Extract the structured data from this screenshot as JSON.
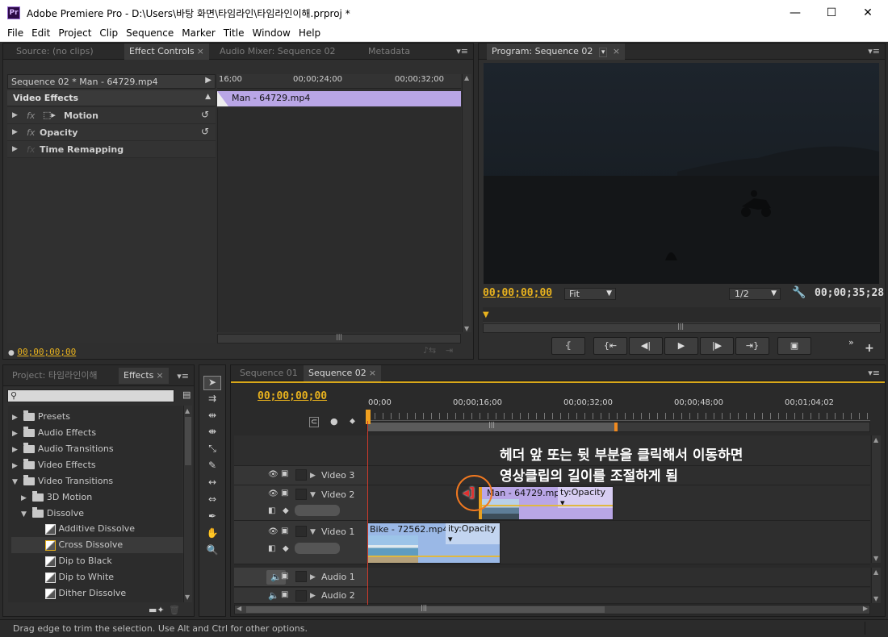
{
  "window": {
    "app_icon": "Pr",
    "title": "Adobe Premiere Pro - D:\\Users\\바탕 화면\\타임라인\\타임라인이해.prproj *",
    "minimize": "—",
    "maximize": "☐",
    "close": "✕"
  },
  "menu": [
    "File",
    "Edit",
    "Project",
    "Clip",
    "Sequence",
    "Marker",
    "Title",
    "Window",
    "Help"
  ],
  "source_panel": {
    "tabs": [
      "Source: (no clips)",
      "Effect Controls",
      "Audio Mixer: Sequence 02",
      "Metadata"
    ],
    "sequence_label": "Sequence 02 * Man - 64729.mp4",
    "ruler": [
      "16;00",
      "00;00;24;00",
      "00;00;32;00"
    ],
    "clip_name": "Man - 64729.mp4",
    "section": "Video Effects",
    "effects": [
      "Motion",
      "Opacity",
      "Time Remapping"
    ],
    "timecode": "00;00;00;00"
  },
  "program_panel": {
    "tab": "Program: Sequence 02",
    "timecode_current": "00;00;00;00",
    "fit": "Fit",
    "resolution": "1/2",
    "timecode_duration": "00;00;35;28"
  },
  "project_panel": {
    "tabs": [
      "Project: 타임라인이해",
      "Effects"
    ],
    "search_placeholder": "",
    "tree": [
      {
        "label": "Presets",
        "level": 0,
        "type": "folder"
      },
      {
        "label": "Audio Effects",
        "level": 0,
        "type": "folder"
      },
      {
        "label": "Audio Transitions",
        "level": 0,
        "type": "folder"
      },
      {
        "label": "Video Effects",
        "level": 0,
        "type": "folder"
      },
      {
        "label": "Video Transitions",
        "level": 0,
        "type": "folder"
      },
      {
        "label": "3D Motion",
        "level": 1,
        "type": "folder"
      },
      {
        "label": "Dissolve",
        "level": 1,
        "type": "folder"
      },
      {
        "label": "Additive Dissolve",
        "level": 2,
        "type": "transition"
      },
      {
        "label": "Cross Dissolve",
        "level": 2,
        "type": "transition"
      },
      {
        "label": "Dip to Black",
        "level": 2,
        "type": "transition"
      },
      {
        "label": "Dip to White",
        "level": 2,
        "type": "transition"
      },
      {
        "label": "Dither Dissolve",
        "level": 2,
        "type": "transition"
      }
    ]
  },
  "timeline": {
    "tabs": [
      "Sequence 01",
      "Sequence 02"
    ],
    "timecode": "00;00;00;00",
    "ruler": [
      "00;00",
      "00;00;16;00",
      "00;00;32;00",
      "00;00;48;00",
      "00;01;04;02"
    ],
    "tracks": [
      "Video 3",
      "Video 2",
      "Video 1",
      "Audio 1",
      "Audio 2"
    ],
    "clip_man": "Man - 64729.mp4",
    "clip_man_fx": "ty:Opacity",
    "clip_bike": "Bike - 72562.mp4",
    "clip_bike_fx": "ity:Opacity",
    "annotation_line1": "헤더 앞 또는 뒷 부분을 클릭해서 이동하면",
    "annotation_line2": "영상클립의 길이를 조절하게 됨"
  },
  "status_bar": "Drag edge to trim the selection. Use Alt and Ctrl for other options.",
  "colors": {
    "timecode": "#e8b21e",
    "clip_video": "#b9a6e6",
    "clip_video1": "#9ab8e6",
    "playhead": "#d03a2b",
    "annotation_circle": "#f07820"
  }
}
